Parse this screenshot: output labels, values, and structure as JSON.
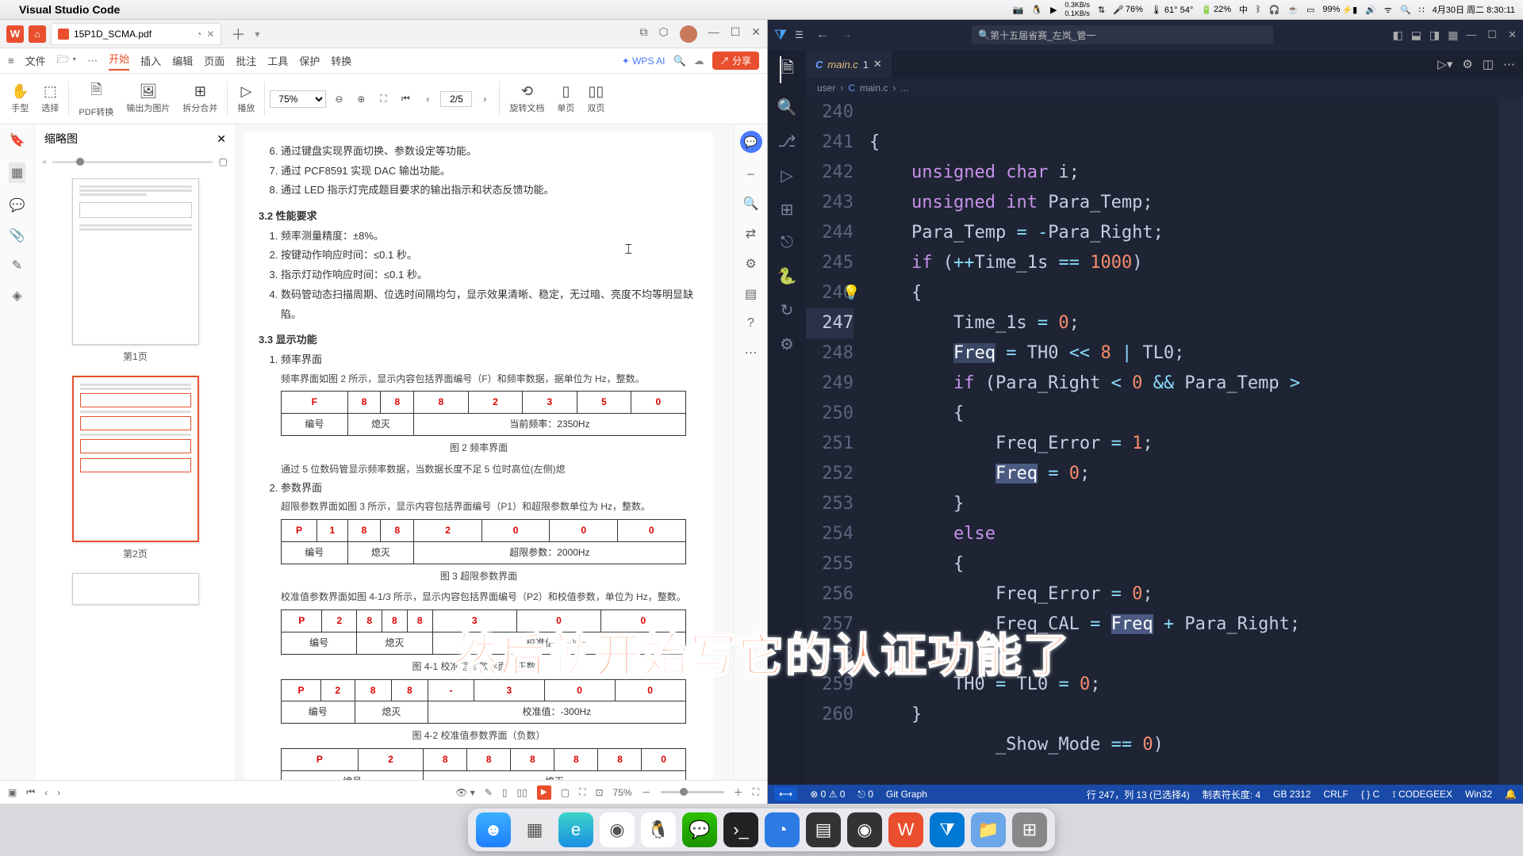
{
  "menubar": {
    "app": "Visual Studio Code",
    "net_up": "0.3KB/s",
    "net_down": "0.1KB/s",
    "mic": "76%",
    "temp": "61°\n54°",
    "batt_pct": "22%",
    "batt2": "99%",
    "date": "4月30日 周二 8:30:11"
  },
  "wps": {
    "tab": "15P1D_SCMA.pdf",
    "menu": {
      "file": "文件",
      "start": "开始",
      "insert": "插入",
      "edit": "编辑",
      "page": "页面",
      "review": "批注",
      "tool": "工具",
      "protect": "保护",
      "convert": "转换",
      "ai": "WPS AI",
      "share": "分享"
    },
    "toolbar": {
      "hand": "手型",
      "select": "选择",
      "pdfconv": "PDF转换",
      "export": "输出为图片",
      "split": "拆分合并",
      "play": "播放",
      "zoom": "75%",
      "rotate": "旋转文档",
      "single": "单页",
      "double": "双页",
      "pageidx": "2/5"
    },
    "thumbs": {
      "title": "缩略图",
      "p1": "第1页",
      "p2": "第2页"
    },
    "doc": {
      "li6": "通过键盘实现界面切换、参数设定等功能。",
      "li7": "通过 PCF8591 实现 DAC 输出功能。",
      "li8": "通过 LED 指示灯完成题目要求的输出指示和状态反馈功能。",
      "h32": "3.2 性能要求",
      "p32_1": "频率测量精度：±8%。",
      "p32_2": "按键动作响应时间：≤0.1 秒。",
      "p32_3": "指示灯动作响应时间：≤0.1 秒。",
      "p32_4": "数码管动态扫描周期、位选时间隔均匀，显示效果清晰、稳定，无过暗、亮度不均等明显缺陷。",
      "h33": "3.3 显示功能",
      "p33_1": "频率界面",
      "p33_1d": "频率界面如图 2 所示，显示内容包括界面编号（F）和频率数据，据单位为 Hz，整数。",
      "fig2": "图 2 频率界面",
      "t1_note": "通过 5 位数码管显示频率数据，当数据长度不足 5 位时高位(左侧)熄",
      "p33_2": "参数界面",
      "p33_2d": "超限参数界面如图 3 所示，显示内容包括界面编号（P1）和超限参数单位为 Hz，整数。",
      "fig3": "图 3 超限参数界面",
      "p33_3d": "校准值参数界面如图 4-1/3 所示，显示内容包括界面编号（P2）和校值参数，单位为 Hz，整数。",
      "fig41": "图 4-1 校准值参数界面（正数）",
      "fig42": "图 4-2 校准值参数界面（负数）",
      "tbl_bh": "编号",
      "tbl_xm": "熄灭",
      "tbl_dq": "当前频率：2350Hz",
      "tbl_cx": "超限参数：2000Hz",
      "tbl_jz1": "校准值：300Hz",
      "tbl_jz2": "校准值：-300Hz",
      "row_f": [
        "F",
        "8",
        "8",
        "8",
        "2",
        "3",
        "5",
        "0"
      ],
      "row_p1": [
        "P",
        "1",
        "8",
        "8",
        "2",
        "0",
        "0",
        "0"
      ],
      "row_p2a": [
        "P",
        "2",
        "8",
        "8",
        "8",
        "3",
        "0",
        "0"
      ],
      "row_p2b": [
        "P",
        "2",
        "8",
        "8",
        "-",
        "3",
        "0",
        "0"
      ],
      "row_p2c": [
        "P",
        "2",
        "8",
        "8",
        "8",
        "8",
        "8",
        "0"
      ]
    },
    "status_zoom": "75%"
  },
  "vscode": {
    "search": "第十五届省赛_左岚_管一",
    "tab": "main.c",
    "crumb_user": "user",
    "crumb_file": "main.c",
    "crumb_more": "...",
    "lines": {
      "240": "{",
      "241": "    unsigned char i;",
      "242": "    unsigned int Para_Temp;",
      "243": "    Para_Temp = -Para_Right;",
      "244": "    if (++Time_1s == 1000)",
      "245": "    {",
      "246": "        Time_1s = 0;",
      "247": "        Freq = TH0 << 8 | TL0;",
      "248": "        if (Para_Right < 0 && Para_Temp >",
      "249": "        {",
      "250": "            Freq_Error = 1;",
      "251": "            Freq = 0;",
      "252": "        }",
      "253": "        else",
      "254": "        {",
      "255": "            Freq_Error = 0;",
      "256": "            Freq_CAL = Freq + Para_Right;",
      "257": "        }",
      "258": "        TH0 = TL0 = 0;",
      "259": "    }",
      "260": "        _Show_Mode == 0)"
    },
    "status": {
      "err": "0",
      "warn": "0",
      "port": "0",
      "git": "Git Graph",
      "pos": "行 247，列 13 (已选择4)",
      "tab": "制表符长度: 4",
      "enc": "GB 2312",
      "eol": "CRLF",
      "lang": "C",
      "ext": "CODEGEEX",
      "os": "Win32"
    }
  },
  "subtitle": "然后就开始写它的认证功能了"
}
